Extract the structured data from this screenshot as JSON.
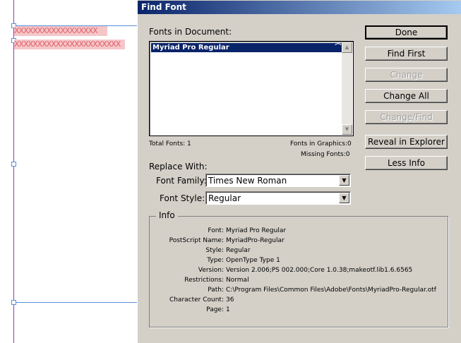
{
  "canvas": {
    "placeholder_lines": [
      "XXXXXXXXXXXXXXXXXX",
      "XXXXXXXXXXXXXXXXXXXXXXX"
    ]
  },
  "dialog": {
    "title": "Find Font",
    "fonts_in_document_label": "Fonts in Document:",
    "fonts_list": [
      {
        "name": "Myriad Pro Regular",
        "type_icon": "opentype-icon"
      }
    ],
    "total_fonts": "Total Fonts: 1",
    "fonts_in_graphics": "Fonts in Graphics:0",
    "missing_fonts": "Missing Fonts:0",
    "replace_with_label": "Replace With:",
    "font_family_label": "Font Family:",
    "font_family_value": "Times New Roman",
    "font_style_label": "Font Style:",
    "font_style_value": "Regular",
    "buttons": {
      "done": "Done",
      "find_first": "Find First",
      "change": "Change",
      "change_all": "Change All",
      "change_find": "Change/Find",
      "reveal": "Reveal in Explorer",
      "less_info": "Less Info"
    },
    "info": {
      "title": "Info",
      "rows": [
        {
          "key": "Font:",
          "value": "Myriad Pro Regular"
        },
        {
          "key": "PostScript Name:",
          "value": "MyriadPro-Regular"
        },
        {
          "key": "Style:",
          "value": "Regular"
        },
        {
          "key": "Type:",
          "value": "OpenType Type 1"
        },
        {
          "key": "Version:",
          "value": "Version 2.006;PS 002.000;Core 1.0.38;makeotf.lib1.6.6565"
        },
        {
          "key": "Restrictions:",
          "value": "Normal"
        },
        {
          "key": "Path:",
          "value": "C:\\Program Files\\Common Files\\Adobe\\Fonts\\MyriadPro-Regular.otf"
        },
        {
          "key": "Character Count:",
          "value": "36"
        },
        {
          "key": "Page:",
          "value": "1"
        }
      ]
    }
  }
}
